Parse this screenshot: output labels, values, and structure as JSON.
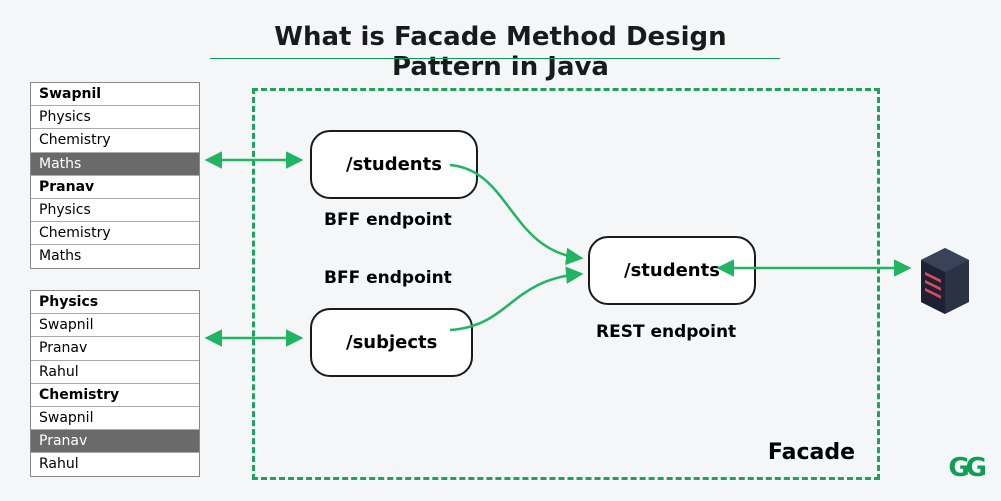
{
  "title": "What is Facade Method Design Pattern in Java",
  "tables": {
    "students": {
      "rows": [
        {
          "text": "Swapnil",
          "cls": "hdr"
        },
        {
          "text": "Physics",
          "cls": ""
        },
        {
          "text": "Chemistry",
          "cls": ""
        },
        {
          "text": "Maths",
          "cls": "dark"
        },
        {
          "text": "Pranav",
          "cls": "hdr"
        },
        {
          "text": "Physics",
          "cls": ""
        },
        {
          "text": "Chemistry",
          "cls": ""
        },
        {
          "text": "Maths",
          "cls": ""
        }
      ]
    },
    "subjects": {
      "rows": [
        {
          "text": "Physics",
          "cls": "hdr"
        },
        {
          "text": "Swapnil",
          "cls": ""
        },
        {
          "text": "Pranav",
          "cls": ""
        },
        {
          "text": "Rahul",
          "cls": ""
        },
        {
          "text": "Chemistry",
          "cls": "hdr"
        },
        {
          "text": "Swapnil",
          "cls": ""
        },
        {
          "text": "Pranav",
          "cls": "dark"
        },
        {
          "text": "Rahul",
          "cls": ""
        }
      ]
    }
  },
  "pills": {
    "bff_students": "/students",
    "bff_subjects": "/subjects",
    "rest_students": "/students"
  },
  "labels": {
    "bff1": "BFF endpoint",
    "bff2": "BFF endpoint",
    "rest": "REST endpoint",
    "facade": "Facade"
  },
  "colors": {
    "accent": "#1ea35a",
    "arrow": "#20b463"
  },
  "logo": "GG"
}
